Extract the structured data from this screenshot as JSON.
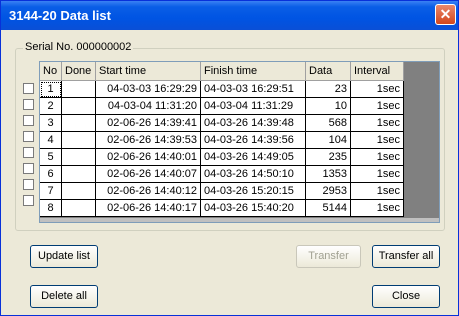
{
  "window": {
    "title": "3144-20 Data list",
    "close_glyph": "✕"
  },
  "group": {
    "legend": "Serial No. 000000002"
  },
  "columns": [
    "No",
    "Done",
    "Start time",
    "Finish time",
    "Data",
    "Interval"
  ],
  "rows": [
    {
      "no": "1",
      "done": "",
      "start": "04-03-03 16:29:29",
      "finish": "04-03-03 16:29:51",
      "data": "23",
      "interval": "1sec"
    },
    {
      "no": "2",
      "done": "",
      "start": "04-03-04 11:31:20",
      "finish": "04-03-04 11:31:29",
      "data": "10",
      "interval": "1sec"
    },
    {
      "no": "3",
      "done": "",
      "start": "02-06-26 14:39:41",
      "finish": "04-03-26 14:39:48",
      "data": "568",
      "interval": "1sec"
    },
    {
      "no": "4",
      "done": "",
      "start": "02-06-26 14:39:53",
      "finish": "04-03-26 14:39:56",
      "data": "104",
      "interval": "1sec"
    },
    {
      "no": "5",
      "done": "",
      "start": "02-06-26 14:40:01",
      "finish": "04-03-26 14:49:05",
      "data": "235",
      "interval": "1sec"
    },
    {
      "no": "6",
      "done": "",
      "start": "02-06-26 14:40:07",
      "finish": "04-03-26 14:50:10",
      "data": "1353",
      "interval": "1sec"
    },
    {
      "no": "7",
      "done": "",
      "start": "02-06-26 14:40:12",
      "finish": "04-03-26 15:20:15",
      "data": "2953",
      "interval": "1sec"
    },
    {
      "no": "8",
      "done": "",
      "start": "02-06-26 14:40:17",
      "finish": "04-03-26 15:40:20",
      "data": "5144",
      "interval": "1sec"
    }
  ],
  "buttons": {
    "update_list": "Update list",
    "delete_all": "Delete all",
    "transfer": "Transfer",
    "transfer_all": "Transfer all",
    "close": "Close"
  }
}
